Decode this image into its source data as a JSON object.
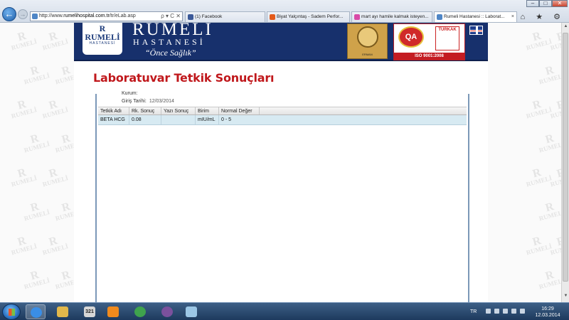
{
  "browser": {
    "url_prefix": "http://www.",
    "url_domain": "rumelihospital.com.tr",
    "url_path": "/tr/eLab.asp",
    "address_tools": "ρ ▾ C ✕",
    "tabs": [
      {
        "label": "(1) Facebook",
        "icon_color": "#3b5998",
        "active": false
      },
      {
        "label": "Biyat Yalçıntaş - Sadem Perfor...",
        "icon_color": "#e35a1a",
        "active": false
      },
      {
        "label": "mart ayı hamile kalmak isteyen...",
        "icon_color": "#d94aa7",
        "active": false
      },
      {
        "label": "Rumeli Hastanesi :: Laborat...",
        "icon_color": "#4f86c6",
        "active": true
      }
    ],
    "tab_close_glyph": "×",
    "window_buttons": {
      "minimize": "–",
      "maximize": "□",
      "close": "✕"
    },
    "toolbar_icons": "⌂ ★ ⚙"
  },
  "header": {
    "logo_monogram": "R",
    "logo_brand": "RUMELİ",
    "logo_brand_sub": "HASTANESİ",
    "name": "RUMELİ",
    "name_sub": "HASTANESİ",
    "slogan": "“Önce Sağlık”",
    "award_caption": "ERMAN",
    "cert_qa": "QA",
    "cert_tse": "TÜRKAK",
    "cert_iso": "ISO 9001:2008"
  },
  "page": {
    "title": "Laboratuvar Tetkik Sonuçları",
    "partial_label": "Kurum:",
    "entry_date_label": "Giriş Tarihi:",
    "entry_date": "12/03/2014"
  },
  "results": {
    "columns": [
      "Tetkik Adı",
      "Rk. Sonuç",
      "Yazı Sonuç",
      "Birim",
      "Normal Değer"
    ],
    "rows": [
      [
        "BETA HCG",
        "0.08",
        "",
        "mIU/mL",
        "0 - 5"
      ]
    ]
  },
  "watermark": {
    "monogram": "R",
    "text": "RUMELİ"
  },
  "taskbar": {
    "apps": [
      {
        "name": "internet-explorer",
        "color": "#3a8ee6",
        "active": true
      },
      {
        "name": "file-explorer",
        "color": "#e2b84b",
        "active": false
      },
      {
        "name": "calendar",
        "color": "#d7d7d7",
        "active": false
      },
      {
        "name": "media-player",
        "color": "#f08a1d",
        "active": false
      },
      {
        "name": "chrome",
        "color": "#3fa34d",
        "active": false
      },
      {
        "name": "viber",
        "color": "#7b519d",
        "active": false
      },
      {
        "name": "paint",
        "color": "#9cc7e6",
        "active": false
      }
    ],
    "calendar_day": "321",
    "language": "TR",
    "time": "16:29",
    "date": "12.03.2014"
  },
  "colors": {
    "title_red": "#c0181c",
    "header_navy": "#17306c",
    "row_highlight": "#d7eaf2"
  }
}
